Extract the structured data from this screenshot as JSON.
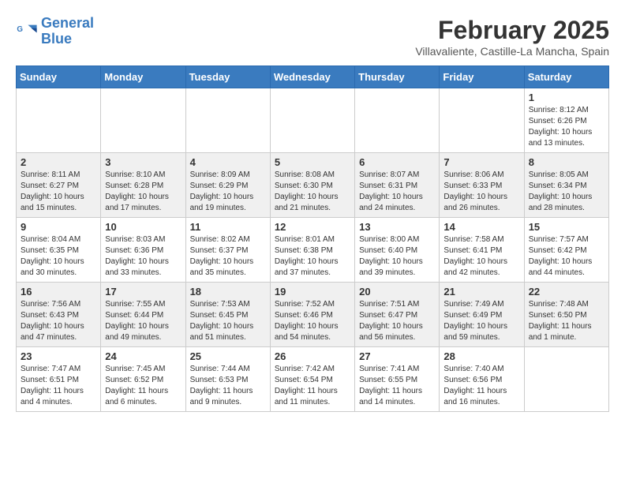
{
  "header": {
    "logo_line1": "General",
    "logo_line2": "Blue",
    "title": "February 2025",
    "subtitle": "Villavaliente, Castille-La Mancha, Spain"
  },
  "weekdays": [
    "Sunday",
    "Monday",
    "Tuesday",
    "Wednesday",
    "Thursday",
    "Friday",
    "Saturday"
  ],
  "weeks": [
    [
      {
        "day": "",
        "info": ""
      },
      {
        "day": "",
        "info": ""
      },
      {
        "day": "",
        "info": ""
      },
      {
        "day": "",
        "info": ""
      },
      {
        "day": "",
        "info": ""
      },
      {
        "day": "",
        "info": ""
      },
      {
        "day": "1",
        "info": "Sunrise: 8:12 AM\nSunset: 6:26 PM\nDaylight: 10 hours and 13 minutes."
      }
    ],
    [
      {
        "day": "2",
        "info": "Sunrise: 8:11 AM\nSunset: 6:27 PM\nDaylight: 10 hours and 15 minutes."
      },
      {
        "day": "3",
        "info": "Sunrise: 8:10 AM\nSunset: 6:28 PM\nDaylight: 10 hours and 17 minutes."
      },
      {
        "day": "4",
        "info": "Sunrise: 8:09 AM\nSunset: 6:29 PM\nDaylight: 10 hours and 19 minutes."
      },
      {
        "day": "5",
        "info": "Sunrise: 8:08 AM\nSunset: 6:30 PM\nDaylight: 10 hours and 21 minutes."
      },
      {
        "day": "6",
        "info": "Sunrise: 8:07 AM\nSunset: 6:31 PM\nDaylight: 10 hours and 24 minutes."
      },
      {
        "day": "7",
        "info": "Sunrise: 8:06 AM\nSunset: 6:33 PM\nDaylight: 10 hours and 26 minutes."
      },
      {
        "day": "8",
        "info": "Sunrise: 8:05 AM\nSunset: 6:34 PM\nDaylight: 10 hours and 28 minutes."
      }
    ],
    [
      {
        "day": "9",
        "info": "Sunrise: 8:04 AM\nSunset: 6:35 PM\nDaylight: 10 hours and 30 minutes."
      },
      {
        "day": "10",
        "info": "Sunrise: 8:03 AM\nSunset: 6:36 PM\nDaylight: 10 hours and 33 minutes."
      },
      {
        "day": "11",
        "info": "Sunrise: 8:02 AM\nSunset: 6:37 PM\nDaylight: 10 hours and 35 minutes."
      },
      {
        "day": "12",
        "info": "Sunrise: 8:01 AM\nSunset: 6:38 PM\nDaylight: 10 hours and 37 minutes."
      },
      {
        "day": "13",
        "info": "Sunrise: 8:00 AM\nSunset: 6:40 PM\nDaylight: 10 hours and 39 minutes."
      },
      {
        "day": "14",
        "info": "Sunrise: 7:58 AM\nSunset: 6:41 PM\nDaylight: 10 hours and 42 minutes."
      },
      {
        "day": "15",
        "info": "Sunrise: 7:57 AM\nSunset: 6:42 PM\nDaylight: 10 hours and 44 minutes."
      }
    ],
    [
      {
        "day": "16",
        "info": "Sunrise: 7:56 AM\nSunset: 6:43 PM\nDaylight: 10 hours and 47 minutes."
      },
      {
        "day": "17",
        "info": "Sunrise: 7:55 AM\nSunset: 6:44 PM\nDaylight: 10 hours and 49 minutes."
      },
      {
        "day": "18",
        "info": "Sunrise: 7:53 AM\nSunset: 6:45 PM\nDaylight: 10 hours and 51 minutes."
      },
      {
        "day": "19",
        "info": "Sunrise: 7:52 AM\nSunset: 6:46 PM\nDaylight: 10 hours and 54 minutes."
      },
      {
        "day": "20",
        "info": "Sunrise: 7:51 AM\nSunset: 6:47 PM\nDaylight: 10 hours and 56 minutes."
      },
      {
        "day": "21",
        "info": "Sunrise: 7:49 AM\nSunset: 6:49 PM\nDaylight: 10 hours and 59 minutes."
      },
      {
        "day": "22",
        "info": "Sunrise: 7:48 AM\nSunset: 6:50 PM\nDaylight: 11 hours and 1 minute."
      }
    ],
    [
      {
        "day": "23",
        "info": "Sunrise: 7:47 AM\nSunset: 6:51 PM\nDaylight: 11 hours and 4 minutes."
      },
      {
        "day": "24",
        "info": "Sunrise: 7:45 AM\nSunset: 6:52 PM\nDaylight: 11 hours and 6 minutes."
      },
      {
        "day": "25",
        "info": "Sunrise: 7:44 AM\nSunset: 6:53 PM\nDaylight: 11 hours and 9 minutes."
      },
      {
        "day": "26",
        "info": "Sunrise: 7:42 AM\nSunset: 6:54 PM\nDaylight: 11 hours and 11 minutes."
      },
      {
        "day": "27",
        "info": "Sunrise: 7:41 AM\nSunset: 6:55 PM\nDaylight: 11 hours and 14 minutes."
      },
      {
        "day": "28",
        "info": "Sunrise: 7:40 AM\nSunset: 6:56 PM\nDaylight: 11 hours and 16 minutes."
      },
      {
        "day": "",
        "info": ""
      }
    ]
  ]
}
